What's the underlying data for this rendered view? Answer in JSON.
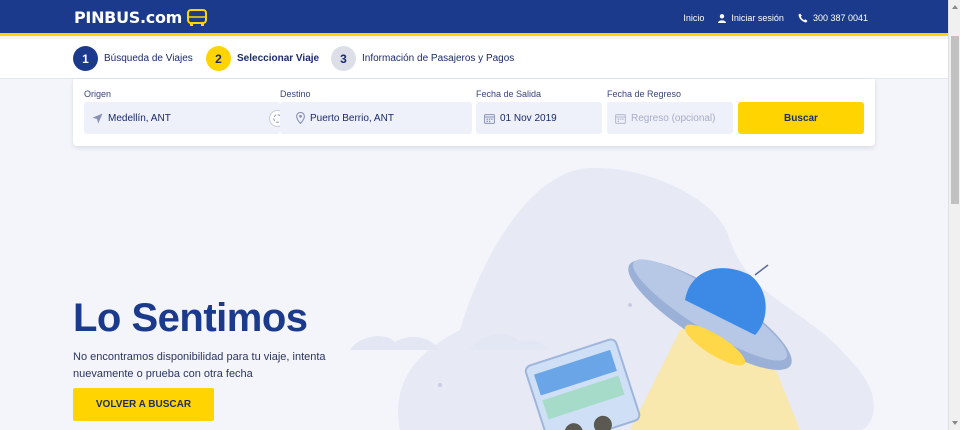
{
  "header": {
    "logo_text": "PINBUS.com",
    "nav": {
      "home": "Inicio",
      "login": "Iniciar sesión",
      "phone": "300 387 0041"
    }
  },
  "steps": [
    {
      "number": "1",
      "label": "Búsqueda de Viajes"
    },
    {
      "number": "2",
      "label": "Seleccionar Viaje"
    },
    {
      "number": "3",
      "label": "Información de Pasajeros y Pagos"
    }
  ],
  "search": {
    "origin_label": "Origen",
    "origin_value": "Medellín, ANT",
    "destination_label": "Destino",
    "destination_value": "Puerto Berrio, ANT",
    "departure_label": "Fecha de Salida",
    "departure_value": "01 Nov 2019",
    "return_label": "Fecha de Regreso",
    "return_placeholder": "Regreso (opcional)",
    "search_button": "Buscar"
  },
  "main": {
    "title": "Lo Sentimos",
    "message": "No encontramos disponibilidad para tu viaje, intenta nuevamente o prueba con otra fecha",
    "back_button": "VOLVER A BUSCAR"
  },
  "colors": {
    "brand_blue": "#1c3a8c",
    "accent_yellow": "#ffd400",
    "background": "#f4f5fb"
  }
}
